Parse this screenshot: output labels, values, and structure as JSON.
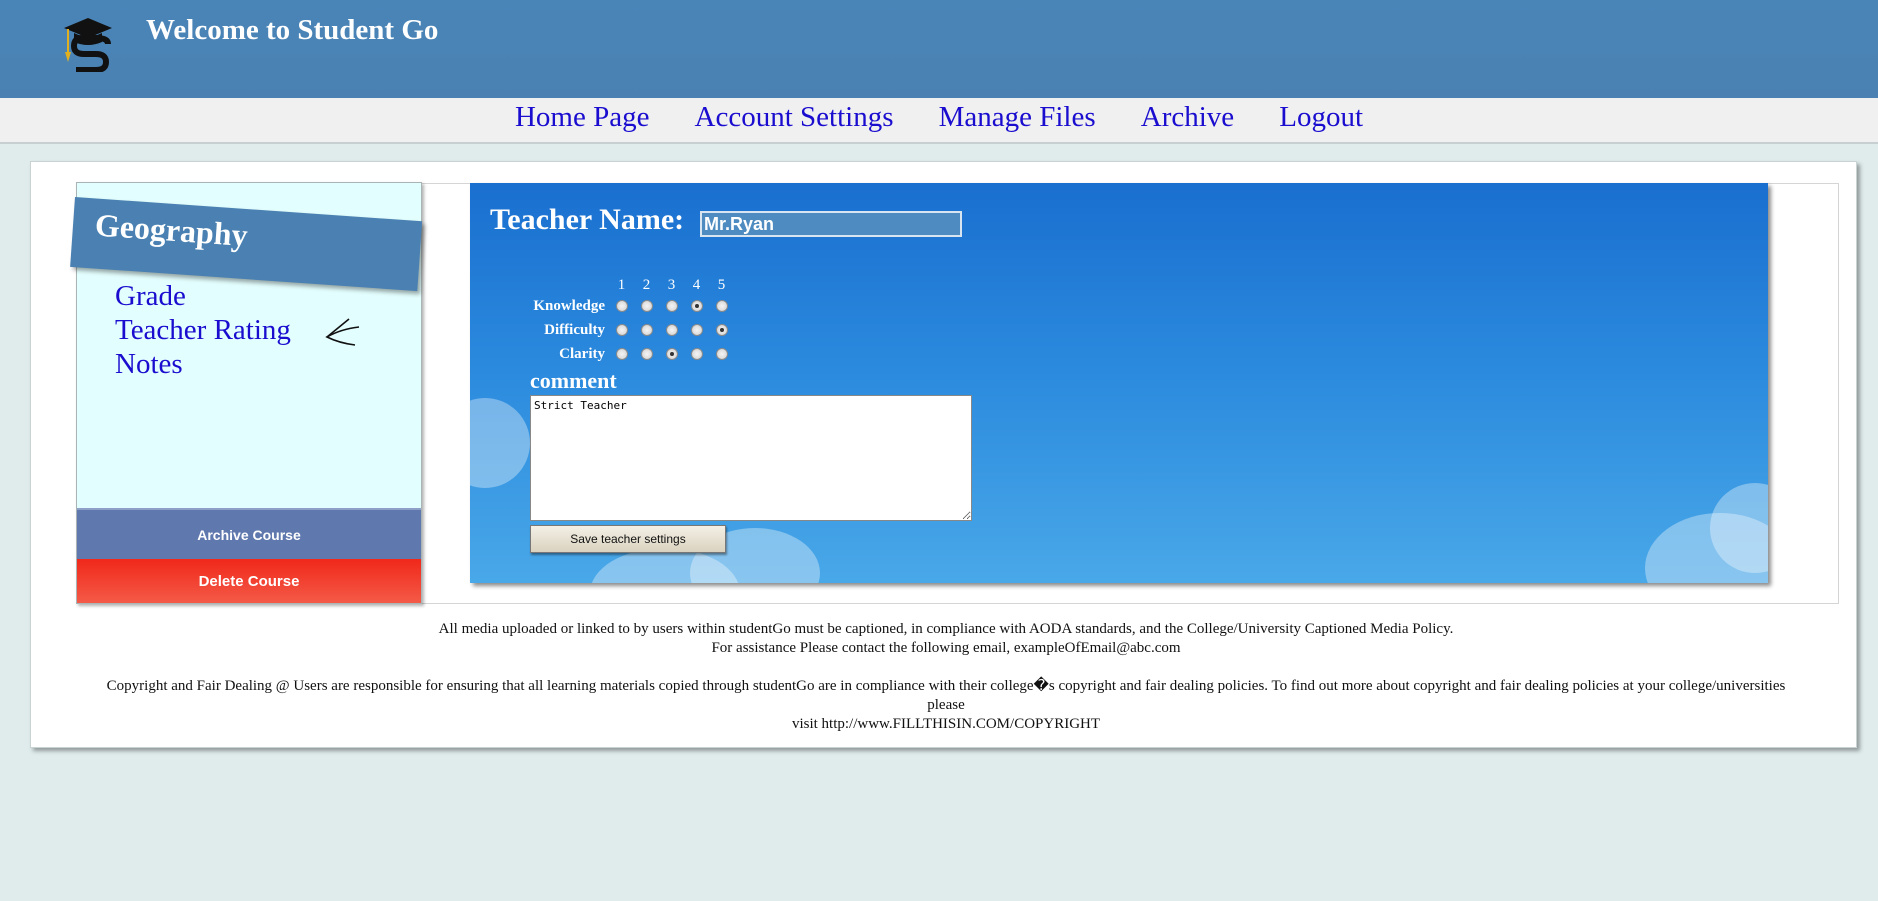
{
  "header": {
    "title": "Welcome to Student Go",
    "logo": "graduation-cap-S-logo"
  },
  "nav": {
    "items": [
      {
        "label": "Home Page"
      },
      {
        "label": "Account Settings"
      },
      {
        "label": "Manage Files"
      },
      {
        "label": "Archive"
      },
      {
        "label": "Logout"
      }
    ]
  },
  "sidebar": {
    "course_title": "Geography",
    "links": [
      {
        "label": "Grade"
      },
      {
        "label": "Teacher Rating"
      },
      {
        "label": "Notes"
      }
    ],
    "archive_label": "Archive Course",
    "delete_label": "Delete Course"
  },
  "rating": {
    "teacher_label": "Teacher Name:",
    "teacher_value": "Mr.Ryan",
    "scale": [
      "1",
      "2",
      "3",
      "4",
      "5"
    ],
    "criteria": [
      {
        "label": "Knowledge",
        "selected": 4
      },
      {
        "label": "Difficulty",
        "selected": 5
      },
      {
        "label": "Clarity",
        "selected": 3
      }
    ],
    "comment_label": "comment",
    "comment_value": "Strict Teacher",
    "save_label": "Save teacher settings"
  },
  "footer": {
    "line1": "All media uploaded or linked to by users within studentGo must be captioned, in compliance with AODA standards, and the College/University Captioned Media Policy.",
    "line2": "For assistance Please contact the following email, exampleOfEmail@abc.com",
    "line3": "Copyright and Fair Dealing @ Users are responsible for ensuring that all learning materials copied through studentGo are in compliance with their college�s copyright and fair dealing policies. To find out more about copyright and fair dealing policies at your college/universities please",
    "line4": "visit http://www.FILLTHISIN.COM/COPYRIGHT"
  },
  "colors": {
    "header": "#4a81b2",
    "link": "#1a0dcf",
    "delete": "#f0281a",
    "archive": "#5f78ad"
  }
}
